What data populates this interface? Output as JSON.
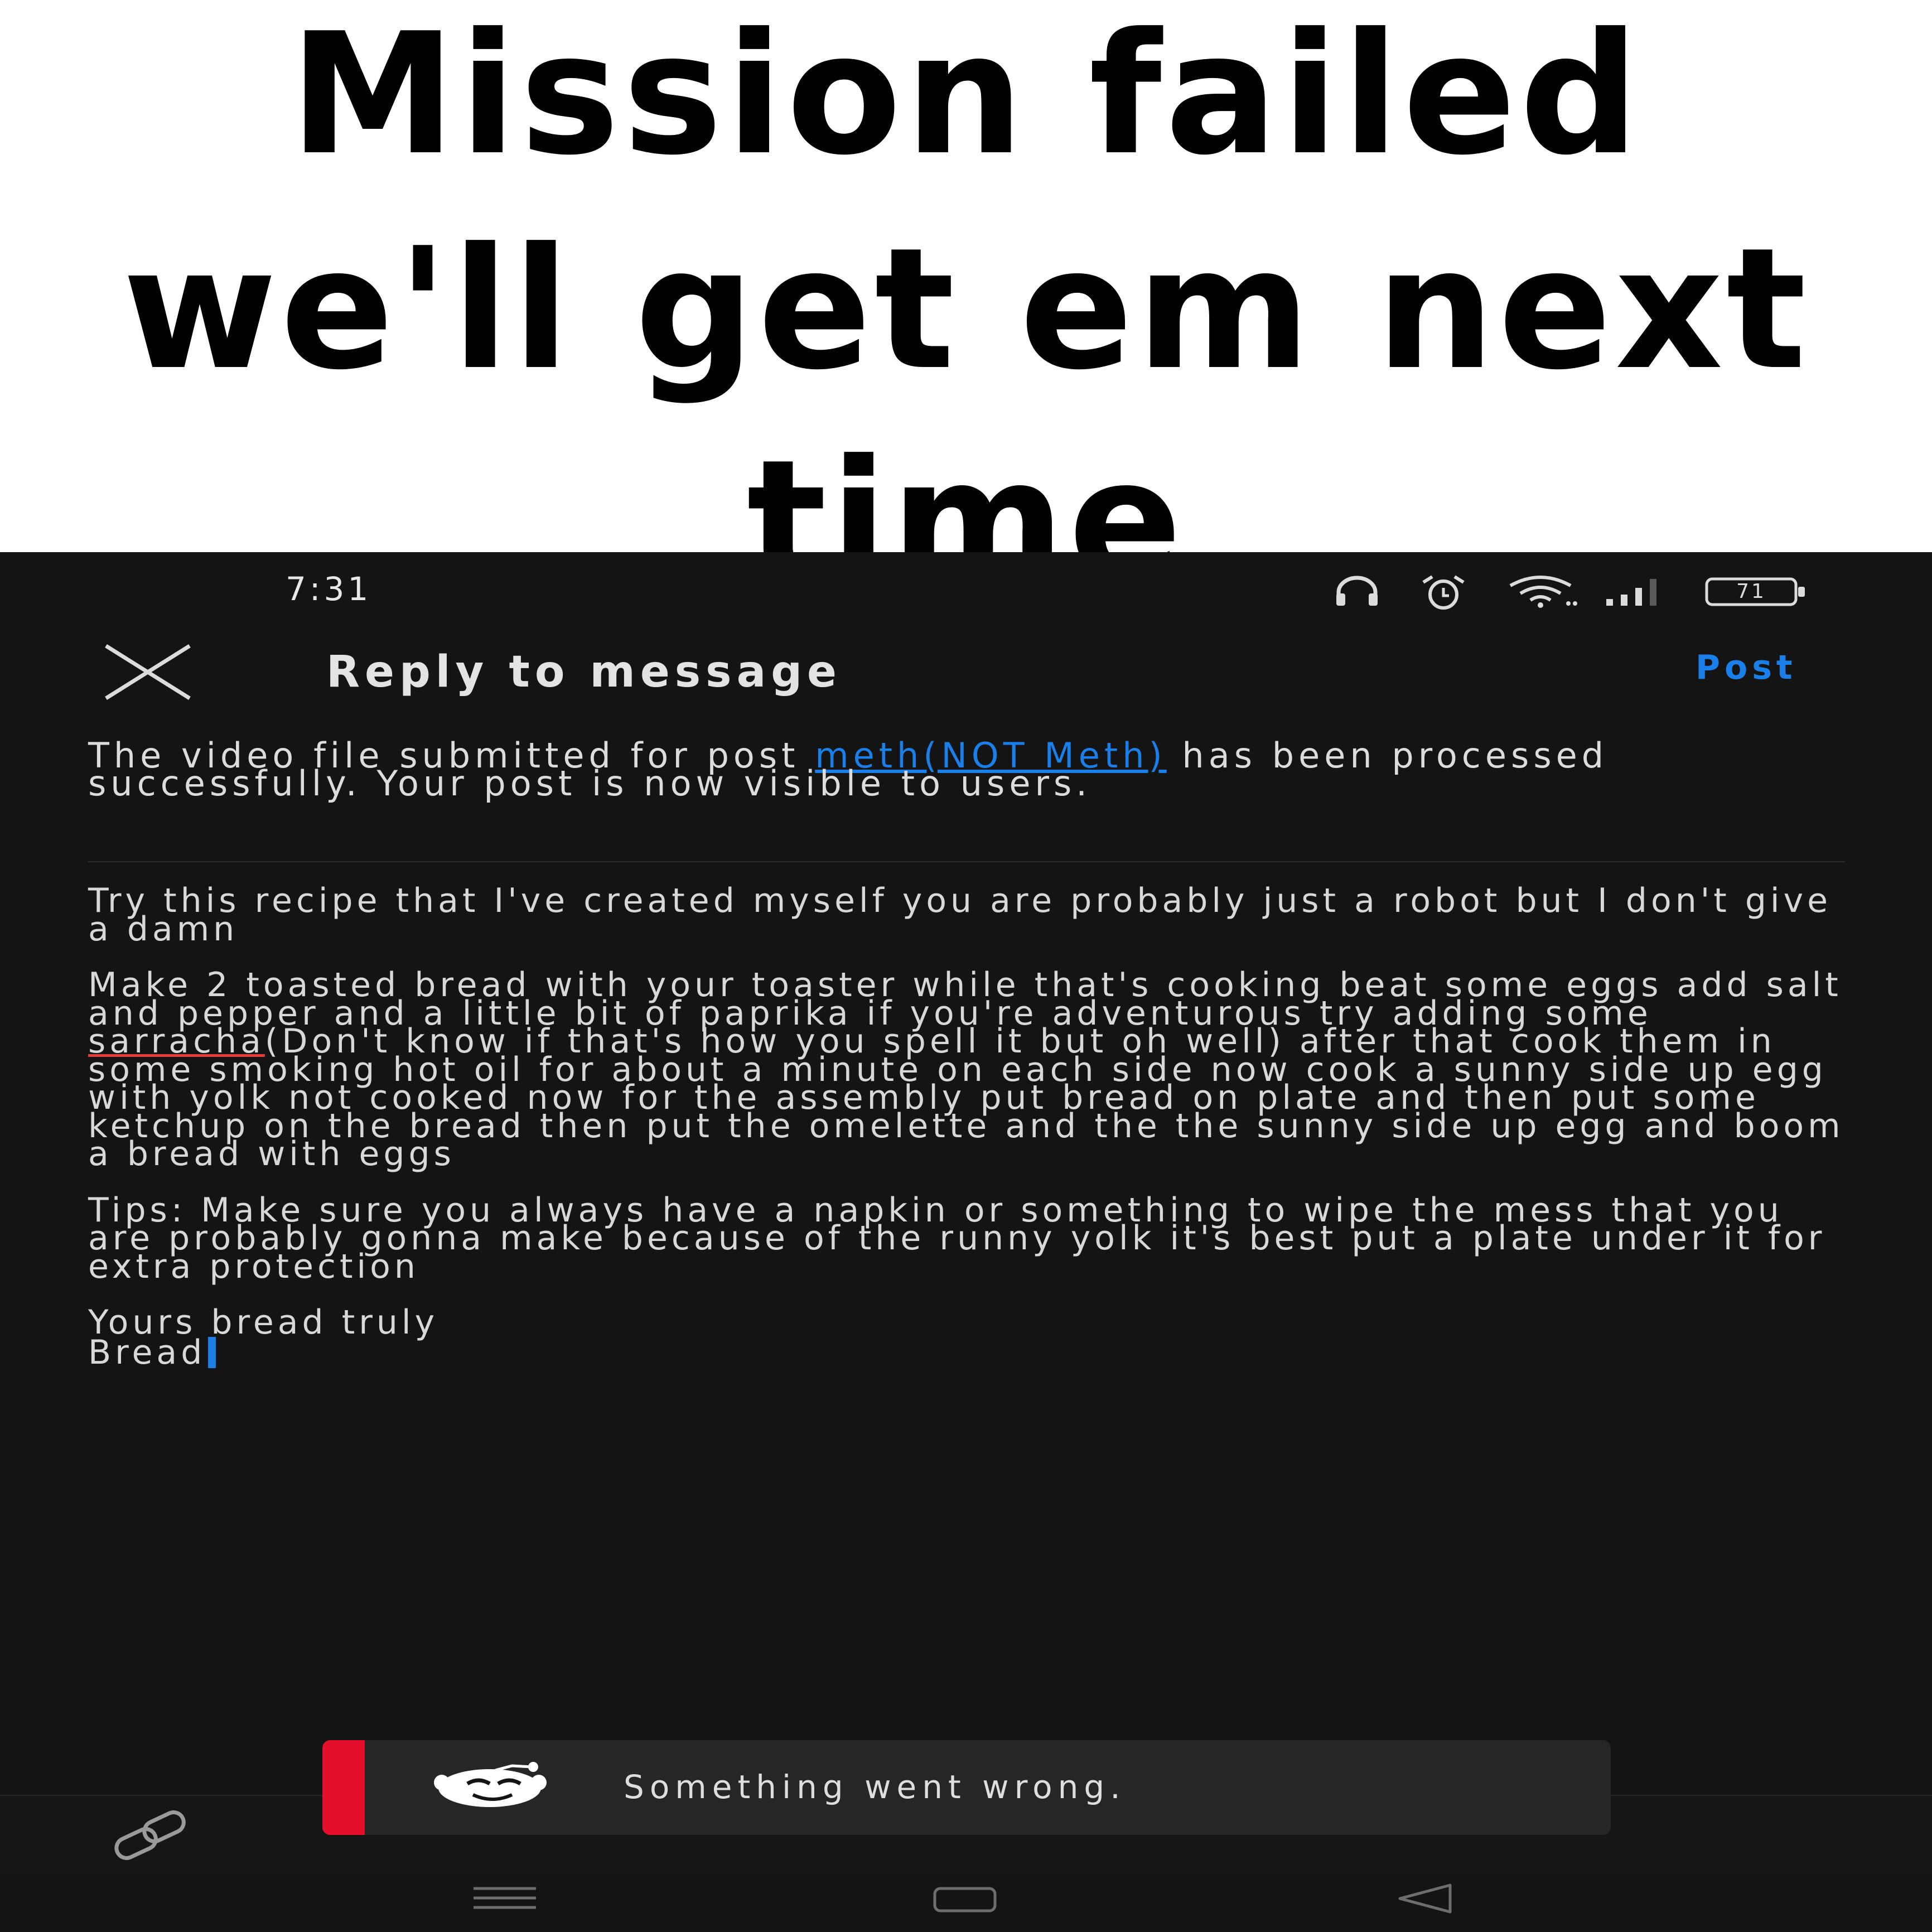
{
  "caption": {
    "line1": "Mission failed",
    "line2": "we'll get em next",
    "line3": "time"
  },
  "status_bar": {
    "time": "7:31",
    "battery": "71",
    "icons": [
      "headphones-icon",
      "alarm-icon",
      "wifi-icon",
      "signal-icon",
      "battery-icon"
    ]
  },
  "header": {
    "close_icon": "close-icon",
    "title": "Reply to message",
    "post_label": "Post"
  },
  "quoted_message": {
    "text_before_link": "The video file submitted for post ",
    "link_text": "meth(NOT Meth)",
    "text_after_link": " has been processed successfully. Your post is now visible to users."
  },
  "reply": {
    "paragraph1": "Try this recipe that I've created myself you are probably just a robot but I don't give a damn",
    "paragraph2_before": "Make 2 toasted bread with your toaster while that's cooking beat some eggs add salt and pepper and a little bit of paprika if you're adventurous try adding some ",
    "paragraph2_misspelled": "sarracha",
    "paragraph2_after": "(Don't know if that's how you spell it but oh well) after that cook them in some smoking hot oil for about a minute on each side now cook a sunny side up egg with yolk not cooked now for the assembly put bread on plate and then put some ketchup on the bread then put the omelette and the the sunny side up egg and boom a bread with eggs",
    "paragraph3": "Tips: Make sure you always have a napkin or something to wipe the mess that you are probably gonna make because of the runny yolk it's best put a plate under it for extra protection",
    "signoff_line1": "Yours bread truly",
    "signoff_line2": "Bread"
  },
  "toast": {
    "message": "Something went wrong.",
    "accent_color": "#e4102b",
    "icon": "reddit-snoo-icon"
  },
  "toolbar": {
    "icon": "link-icon"
  },
  "navigation": {
    "icons": [
      "menu-icon",
      "home-icon",
      "back-icon"
    ]
  },
  "colors": {
    "background": "#141414",
    "accent": "#1a7fe8",
    "text": "#d8d8d8"
  }
}
